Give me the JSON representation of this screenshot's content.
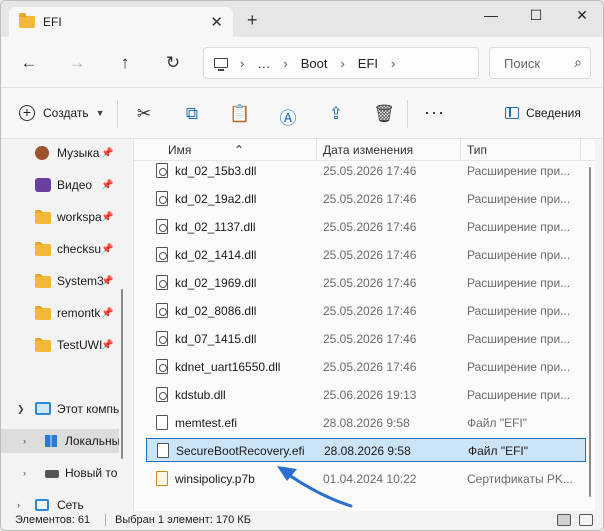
{
  "window": {
    "tab_title": "EFI",
    "tab_close": "✕",
    "tab_new": "+",
    "minimize": "—",
    "maximize": "☐",
    "close": "✕"
  },
  "nav": {
    "back": "←",
    "forward": "→",
    "up": "↑",
    "refresh": "↻",
    "breadcrumb": [
      "…",
      "Boot",
      "EFI"
    ],
    "search_placeholder": "Поиск"
  },
  "commands": {
    "create_label": "Создать",
    "details_label": "Сведения",
    "more": "···"
  },
  "sidebar": {
    "items": [
      {
        "label": "Музыка",
        "icon": "music-icon",
        "pinned": true
      },
      {
        "label": "Видео",
        "icon": "video-icon",
        "pinned": true
      },
      {
        "label": "workspa",
        "icon": "folder-icon",
        "pinned": true
      },
      {
        "label": "checksu",
        "icon": "folder-icon",
        "pinned": true
      },
      {
        "label": "System3",
        "icon": "folder-icon",
        "pinned": true
      },
      {
        "label": "remontk",
        "icon": "folder-icon",
        "pinned": true
      },
      {
        "label": "TestUWI",
        "icon": "folder-icon",
        "pinned": true
      },
      {
        "label": "Этот компь",
        "icon": "computer-icon",
        "pinned": false
      },
      {
        "label": "Локальны",
        "icon": "local-disk-icon",
        "pinned": false
      },
      {
        "label": "Новый то",
        "icon": "drive-icon",
        "pinned": false
      },
      {
        "label": "Сеть",
        "icon": "network-icon",
        "pinned": false
      }
    ]
  },
  "columns": {
    "name": "Имя",
    "date": "Дата изменения",
    "type": "Тип"
  },
  "files": [
    {
      "name": "kd_02_15b3.dll",
      "date": "25.05.2026 17:46",
      "type": "Расширение при...",
      "kind": "dll"
    },
    {
      "name": "kd_02_19a2.dll",
      "date": "25.05.2026 17:46",
      "type": "Расширение при...",
      "kind": "dll"
    },
    {
      "name": "kd_02_1137.dll",
      "date": "25.05.2026 17:46",
      "type": "Расширение при...",
      "kind": "dll"
    },
    {
      "name": "kd_02_1414.dll",
      "date": "25.05.2026 17:46",
      "type": "Расширение при...",
      "kind": "dll"
    },
    {
      "name": "kd_02_1969.dll",
      "date": "25.05.2026 17:46",
      "type": "Расширение при...",
      "kind": "dll"
    },
    {
      "name": "kd_02_8086.dll",
      "date": "25.05.2026 17:46",
      "type": "Расширение при...",
      "kind": "dll"
    },
    {
      "name": "kd_07_1415.dll",
      "date": "25.05.2026 17:46",
      "type": "Расширение при...",
      "kind": "dll"
    },
    {
      "name": "kdnet_uart16550.dll",
      "date": "25.05.2026 17:46",
      "type": "Расширение при...",
      "kind": "dll"
    },
    {
      "name": "kdstub.dll",
      "date": "25.06.2026 19:13",
      "type": "Расширение при...",
      "kind": "dll"
    },
    {
      "name": "memtest.efi",
      "date": "28.08.2026 9:58",
      "type": "Файл \"EFI\"",
      "kind": "efi"
    },
    {
      "name": "SecureBootRecovery.efi",
      "date": "28.08.2026 9:58",
      "type": "Файл \"EFI\"",
      "kind": "efi",
      "selected": true
    },
    {
      "name": "winsipolicy.p7b",
      "date": "01.04.2024 10:22",
      "type": "Сертификаты PK...",
      "kind": "cert"
    }
  ],
  "status": {
    "items_count": "Элементов: 61",
    "selected": "Выбран 1 элемент: 170 КБ"
  },
  "colors": {
    "accent": "#1e6fb8",
    "selection": "#cce4f7",
    "annotation_arrow": "#2a6fcf"
  }
}
